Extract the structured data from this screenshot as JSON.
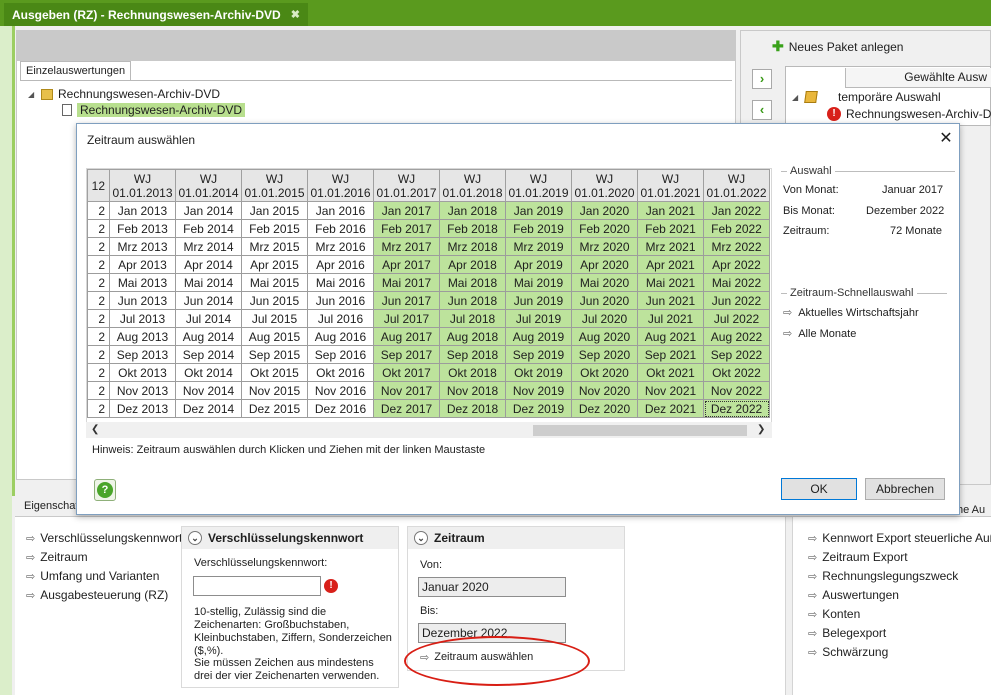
{
  "window": {
    "tab_title": "Ausgeben (RZ) - Rechnungswesen-Archiv-DVD",
    "close_glyph": "✖"
  },
  "left_panel": {
    "tab_label": "Einzelauswertungen",
    "tree": [
      {
        "label": "Rechnungswesen-Archiv-DVD"
      },
      {
        "label": "Rechnungswesen-Archiv-DVD"
      }
    ]
  },
  "right_panel": {
    "new_package_label": "Neues Paket anlegen",
    "column_header": "Gewählte Ausw",
    "items": [
      {
        "label": "temporäre Auswahl"
      },
      {
        "label": "Rechnungswesen-Archiv-DVD"
      }
    ]
  },
  "dialog": {
    "title": "Zeitraum auswählen",
    "partial_col_header": "12",
    "partial_col_cell": "2",
    "columns": [
      {
        "wj": "WJ",
        "date": "01.01.2013",
        "year": "2013",
        "selected": false
      },
      {
        "wj": "WJ",
        "date": "01.01.2014",
        "year": "2014",
        "selected": false
      },
      {
        "wj": "WJ",
        "date": "01.01.2015",
        "year": "2015",
        "selected": false
      },
      {
        "wj": "WJ",
        "date": "01.01.2016",
        "year": "2016",
        "selected": false
      },
      {
        "wj": "WJ",
        "date": "01.01.2017",
        "year": "2017",
        "selected": true
      },
      {
        "wj": "WJ",
        "date": "01.01.2018",
        "year": "2018",
        "selected": true
      },
      {
        "wj": "WJ",
        "date": "01.01.2019",
        "year": "2019",
        "selected": true
      },
      {
        "wj": "WJ",
        "date": "01.01.2020",
        "year": "2020",
        "selected": true
      },
      {
        "wj": "WJ",
        "date": "01.01.2021",
        "year": "2021",
        "selected": true
      },
      {
        "wj": "WJ",
        "date": "01.01.2022",
        "year": "2022",
        "selected": true
      }
    ],
    "months": [
      "Jan",
      "Feb",
      "Mrz",
      "Apr",
      "Mai",
      "Jun",
      "Jul",
      "Aug",
      "Sep",
      "Okt",
      "Nov",
      "Dez"
    ],
    "hint": "Hinweis:  Zeitraum auswählen durch Klicken und Ziehen mit der linken Maustaste",
    "auswahl": {
      "title": "Auswahl",
      "von_label": "Von Monat:",
      "von_value": "Januar 2017",
      "bis_label": "Bis Monat:",
      "bis_value": "Dezember 2022",
      "zeitraum_label": "Zeitraum:",
      "zeitraum_value": "72 Monate"
    },
    "schnellauswahl": {
      "title": "Zeitraum-Schnellauswahl",
      "items": [
        "Aktuelles Wirtschaftsjahr",
        "Alle Monate"
      ]
    },
    "ok_label": "OK",
    "cancel_label": "Abbrechen",
    "help_glyph": "?"
  },
  "bottom": {
    "eig_label": "Eigenschaf",
    "right_clip_label": "he Au",
    "left_links": [
      "Verschlüsselungskennwort",
      "Zeitraum",
      "Umfang und Varianten",
      "Ausgabesteuerung (RZ)"
    ],
    "kennwort_section": {
      "title": "Verschlüsselungskennwort",
      "field_label": "Verschlüsselungskennwort:",
      "field_value": "",
      "info1": "10-stellig, Zulässig sind die Zeichenarten: Großbuchstaben, Kleinbuchstaben, Ziffern, Sonderzeichen ($,%).",
      "info2": "Sie müssen Zeichen aus mindestens drei der vier Zeichenarten verwenden."
    },
    "zeitraum_section": {
      "title": "Zeitraum",
      "von_label": "Von:",
      "von_value": "Januar 2020",
      "bis_label": "Bis:",
      "bis_value": "Dezember 2022",
      "select_link": "Zeitraum auswählen"
    },
    "right_links": [
      "Kennwort Export steuerliche Außenp",
      "Zeitraum Export",
      "Rechnungslegungszweck",
      "Auswertungen",
      "Konten",
      "Belegexport",
      "Schwärzung"
    ]
  }
}
